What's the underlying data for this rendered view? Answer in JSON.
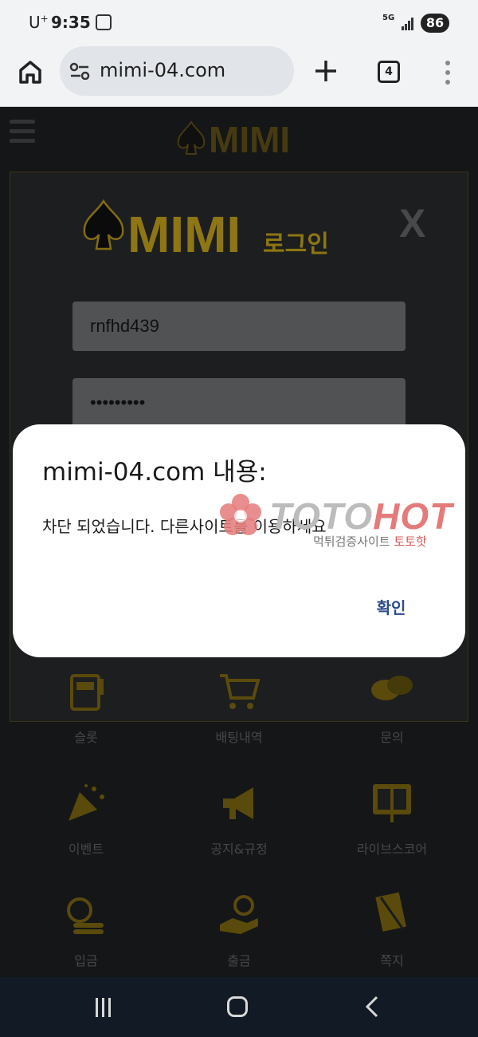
{
  "status_bar": {
    "carrier": "U",
    "carrier_sup": "+",
    "time": "9:35",
    "network": "5G",
    "battery": "86"
  },
  "browser": {
    "url": "mimi-04.com",
    "tab_count": "4"
  },
  "site": {
    "logo_text": "MIMI",
    "login_text": "로그인",
    "close_label": "X"
  },
  "login_form": {
    "username_value": "rnfhd439",
    "password_value": "•••••••••"
  },
  "menu": [
    {
      "label": "슬롯",
      "icon": "slot-machine-icon"
    },
    {
      "label": "배팅내역",
      "icon": "cart-icon"
    },
    {
      "label": "문의",
      "icon": "chat-bubbles-icon"
    },
    {
      "label": "이벤트",
      "icon": "party-popper-icon"
    },
    {
      "label": "공지&규정",
      "icon": "megaphone-icon"
    },
    {
      "label": "라이브스코어",
      "icon": "scoreboard-icon"
    },
    {
      "label": "입금",
      "icon": "coins-icon"
    },
    {
      "label": "출금",
      "icon": "hand-coin-icon"
    },
    {
      "label": "쪽지",
      "icon": "envelope-icon"
    }
  ],
  "dialog": {
    "title": "mimi-04.com 내용:",
    "message": "차단 되었습니다. 다른사이트를 이용하세요",
    "ok_label": "확인"
  },
  "watermark": {
    "brand_a": "TOTO",
    "brand_b": "HOT",
    "subtitle": "먹튀검증사이트",
    "subtitle_accent": "토토핫"
  },
  "colors": {
    "gold": "#d9b51e",
    "dialog_button": "#2b4d8c",
    "watermark_red": "#e57a7a"
  }
}
